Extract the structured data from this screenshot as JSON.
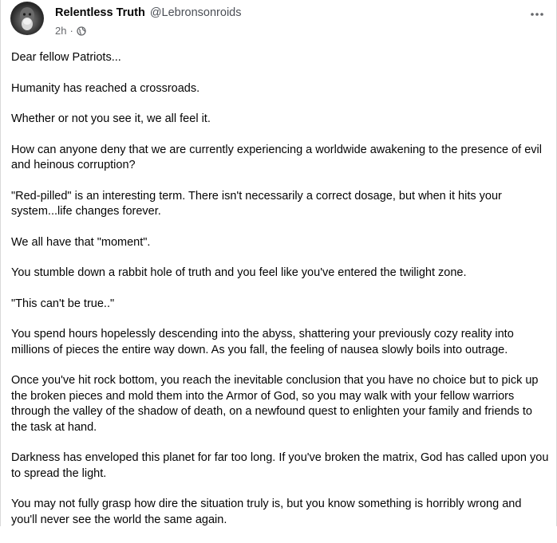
{
  "post": {
    "author": "Relentless Truth",
    "handle": "@Lebronsonroids",
    "time": "2h",
    "separator": "·",
    "audience_icon": "globe-icon",
    "menu_icon": "more-options-icon",
    "paragraphs": [
      "Dear fellow Patriots...",
      "Humanity has reached a crossroads.",
      "Whether or not you see it, we all feel it.",
      "How can anyone deny that we are currently experiencing a worldwide awakening to the presence of evil and heinous corruption?",
      "\"Red-pilled\" is an interesting term. There isn't necessarily a correct dosage, but when it hits your system...life changes forever.",
      "We all have that \"moment\".",
      "You stumble down a rabbit hole of truth and you feel like you've entered the twilight zone.",
      "\"This can't be true..\"",
      "You spend hours hopelessly descending into the abyss, shattering your previously cozy reality into millions of pieces the entire way down. As you fall, the feeling of nausea slowly boils into outrage.",
      "Once you've hit rock bottom, you reach the inevitable conclusion that you have no choice but to pick up the broken pieces and mold them into the Armor of God, so you may walk with your fellow warriors through the valley of the shadow of death, on a newfound quest to enlighten your family and friends to the task at hand.",
      "Darkness has enveloped this planet for far too long. If you've broken the matrix, God has called upon you to spread the light.",
      "You may not fully grasp how dire the situation truly is, but you know something is horribly wrong and you'll never see the world the same again."
    ]
  }
}
